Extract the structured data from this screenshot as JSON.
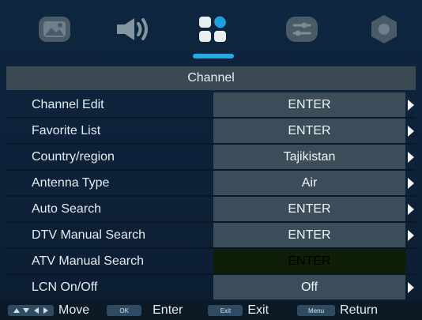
{
  "header": {
    "title": "Channel"
  },
  "tabs": [
    {
      "icon": "picture-icon"
    },
    {
      "icon": "sound-icon"
    },
    {
      "icon": "channel-icon"
    },
    {
      "icon": "settings-sliders-icon"
    },
    {
      "icon": "lock-icon"
    }
  ],
  "menu": {
    "items": [
      {
        "label": "Channel Edit",
        "value": "ENTER"
      },
      {
        "label": "Favorite List",
        "value": "ENTER"
      },
      {
        "label": "Country/region",
        "value": "Tajikistan"
      },
      {
        "label": "Antenna Type",
        "value": "Air"
      },
      {
        "label": "Auto Search",
        "value": "ENTER"
      },
      {
        "label": "DTV Manual Search",
        "value": "ENTER"
      },
      {
        "label": "ATV Manual Search",
        "value": "ENTER"
      },
      {
        "label": "LCN On/Off",
        "value": "Off"
      }
    ]
  },
  "footer": {
    "move_label": "Move",
    "ok_key": "OK",
    "enter_label": "Enter",
    "exit_key": "Exit",
    "exit_label": "Exit",
    "menu_key": "Menu",
    "return_label": "Return"
  },
  "colors": {
    "background": "#0e2640",
    "title_bar": "#3b4a52",
    "value_cell": "#3b4d59",
    "value_cell_disabled": "#0f1f07",
    "accent": "#28a9e2"
  }
}
